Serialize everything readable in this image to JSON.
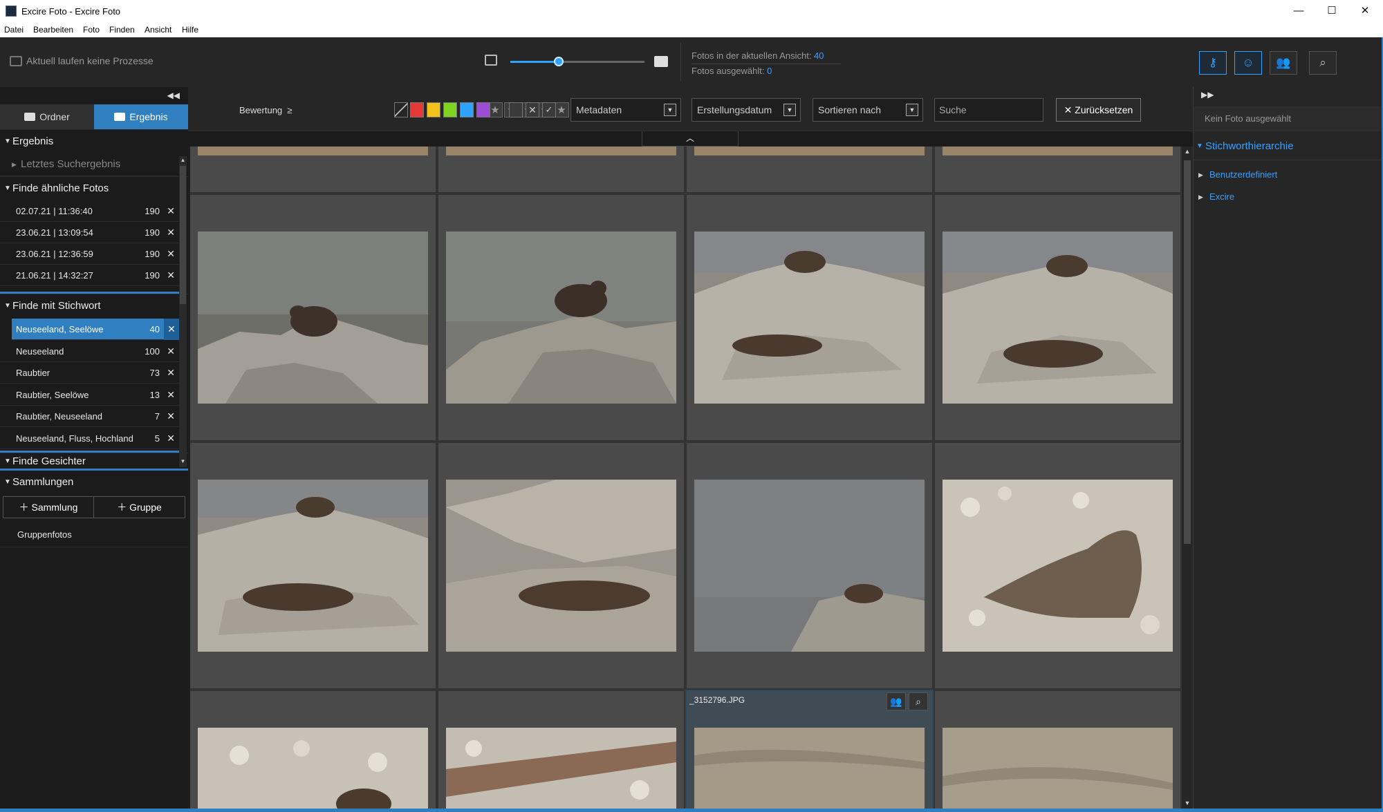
{
  "window": {
    "title": "Excire Foto - Excire Foto",
    "min": "—",
    "max": "☐",
    "close": "✕"
  },
  "menu": [
    "Datei",
    "Bearbeiten",
    "Foto",
    "Finden",
    "Ansicht",
    "Hilfe"
  ],
  "toolbar": {
    "status": "Aktuell laufen keine Prozesse",
    "zoom_level": 0.36,
    "count_label": "Fotos in der aktuellen Ansicht:",
    "count_value": "40",
    "selected_label": "Fotos ausgewählt:",
    "selected_value": "0"
  },
  "right_toolbar": {
    "icons": [
      "key-icon",
      "face-icon",
      "people-icon",
      "search-icon"
    ]
  },
  "left_panel": {
    "tabs": [
      {
        "label": "Ordner",
        "icon": "folder-icon"
      },
      {
        "label": "Ergebnis",
        "icon": "search-icon",
        "active": true
      }
    ],
    "ergebnis": {
      "title": "Ergebnis",
      "last_search": "Letztes Suchergebnis"
    },
    "similar": {
      "title": "Finde ähnliche Fotos",
      "rows": [
        {
          "label": "02.07.21 | 11:36:40",
          "count": "190"
        },
        {
          "label": "23.06.21 | 13:09:54",
          "count": "190"
        },
        {
          "label": "23.06.21 | 12:36:59",
          "count": "190"
        },
        {
          "label": "21.06.21 | 14:32:27",
          "count": "190"
        }
      ]
    },
    "keyword": {
      "title": "Finde mit Stichwort",
      "rows": [
        {
          "label": "Neuseeland, Seelöwe",
          "count": "40",
          "selected": true
        },
        {
          "label": "Neuseeland",
          "count": "100"
        },
        {
          "label": "Raubtier",
          "count": "73"
        },
        {
          "label": "Raubtier, Seelöwe",
          "count": "13"
        },
        {
          "label": "Raubtier, Neuseeland",
          "count": "7"
        },
        {
          "label": "Neuseeland, Fluss, Hochland",
          "count": "5"
        }
      ]
    },
    "faces": {
      "title": "Finde Gesichter"
    },
    "collections": {
      "title": "Sammlungen",
      "add_collection": "Sammlung",
      "add_group": "Gruppe",
      "items": [
        "Gruppenfotos"
      ]
    },
    "remove_glyph": "✕"
  },
  "filter": {
    "rating_label": "Bewertung",
    "rating_op": "≥",
    "metadata": "Metadaten",
    "date": "Erstellungsdatum",
    "sort": "Sortieren nach",
    "search_placeholder": "Suche",
    "reset": "Zurücksetzen",
    "colors": [
      "#e53935",
      "#f2c21b",
      "#7ed321",
      "#2ea3ff",
      "#9b4dd3"
    ]
  },
  "grid": {
    "hover_filename": "_3152796.JPG"
  },
  "right_panel": {
    "no_photo": "Kein Foto ausgewählt",
    "hierarchy_title": "Stichworthierarchie",
    "items": [
      "Benutzerdefiniert",
      "Excire"
    ]
  },
  "colors": {
    "accent": "#2ea3ff",
    "selection": "#2f7fc1"
  }
}
